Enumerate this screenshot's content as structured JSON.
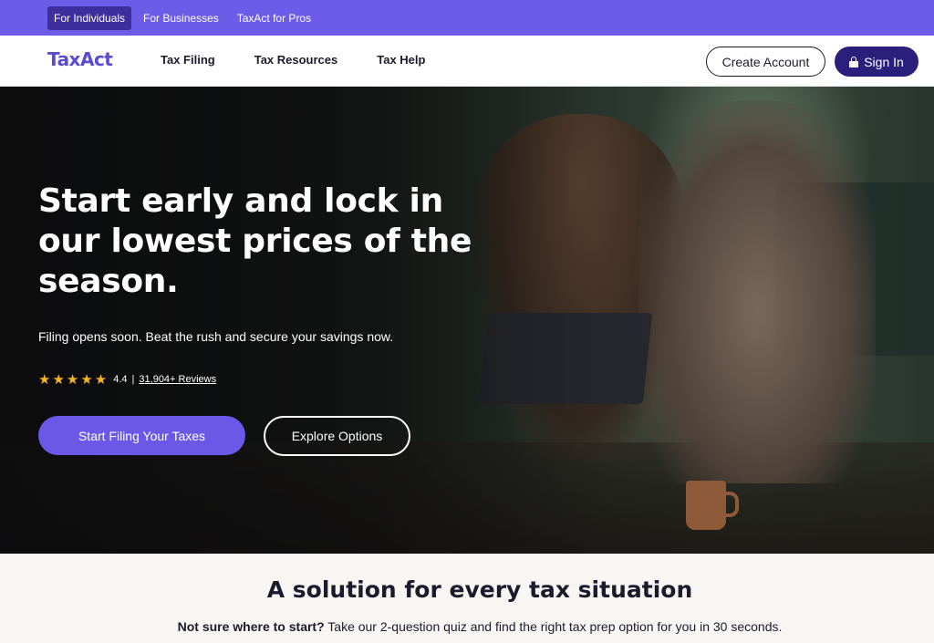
{
  "topbar": {
    "segments": [
      "For Individuals",
      "For Businesses",
      "TaxAct for Pros"
    ]
  },
  "nav": {
    "logo": "TaxAct",
    "links": [
      "Tax Filing",
      "Tax Resources",
      "Tax Help"
    ],
    "create_account": "Create Account",
    "sign_in": "Sign In"
  },
  "hero": {
    "title": "Start early and lock in our lowest prices of the season.",
    "subtitle": "Filing opens soon. Beat the rush and secure your savings now.",
    "rating_value": "4.4",
    "rating_divider": "|",
    "reviews": "31,904+ Reviews",
    "stars": 5,
    "primary_cta": "Start Filing Your Taxes",
    "secondary_cta": "Explore Options"
  },
  "solutions": {
    "title": "A solution for every tax situation",
    "lead": "Not sure where to start?",
    "text": " Take our 2-question quiz and find the right tax prep option for you in 30 seconds."
  },
  "colors": {
    "brand_purple": "#6c5ce7",
    "dark_purple": "#2a1f7a",
    "star_gold": "#f5b32a"
  }
}
